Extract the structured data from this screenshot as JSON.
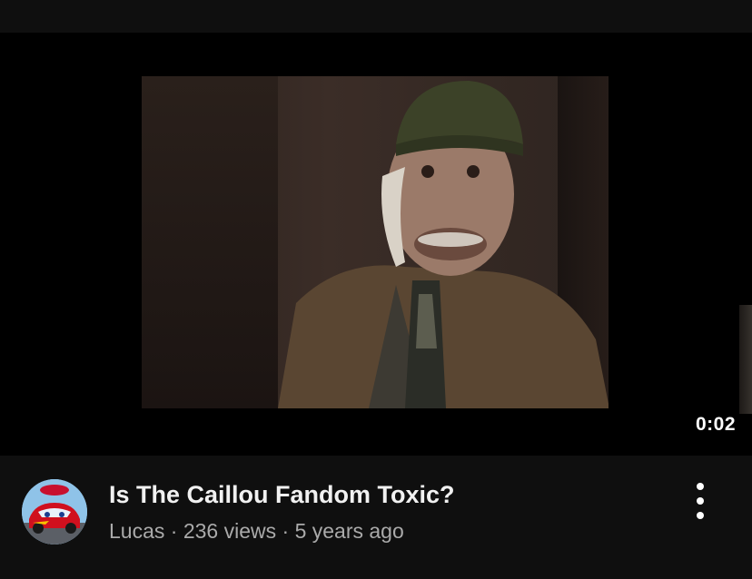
{
  "video": {
    "duration": "0:02",
    "title": "Is The Caillou Fandom Toxic?",
    "channel": "Lucas",
    "separator": "·",
    "views": "236 views",
    "age": "5 years ago"
  },
  "icons": {
    "more": "more-vertical-icon",
    "avatar": "cars-lightning-mcqueen-avatar"
  },
  "colors": {
    "background": "#0f0f0f",
    "title_text": "#f1f1f1",
    "meta_text": "#aaaaaa"
  }
}
